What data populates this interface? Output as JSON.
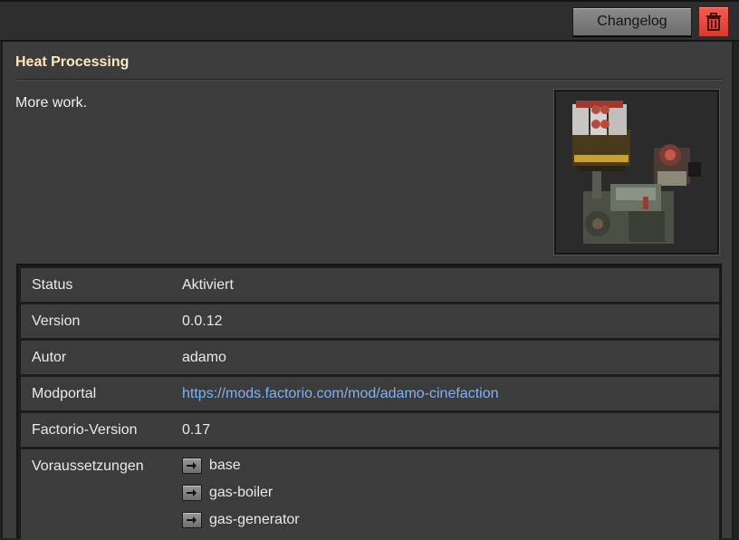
{
  "toolbar": {
    "changelog_label": "Changelog",
    "delete_icon": "trash-icon",
    "delete_color": "#e94b41"
  },
  "mod": {
    "title": "Heat Processing",
    "description": "More work.",
    "thumbnail_icon": "heat-processing-machines-image"
  },
  "info": {
    "rows": [
      {
        "label": "Status",
        "value": "Aktiviert"
      },
      {
        "label": "Version",
        "value": "0.0.12"
      },
      {
        "label": "Autor",
        "value": "adamo"
      },
      {
        "label": "Modportal",
        "value": "https://mods.factorio.com/mod/adamo-cinefaction"
      },
      {
        "label": "Factorio-Version",
        "value": "0.17"
      },
      {
        "label": "Voraussetzungen",
        "value": ""
      }
    ],
    "dependencies": [
      {
        "name": "base",
        "icon": "arrow-right-icon"
      },
      {
        "name": "gas-boiler",
        "icon": "arrow-right-icon"
      },
      {
        "name": "gas-generator",
        "icon": "arrow-right-icon"
      }
    ]
  },
  "colors": {
    "link": "#7fb2f2",
    "title": "#ffe6c0",
    "panel": "#3d3c3d"
  }
}
